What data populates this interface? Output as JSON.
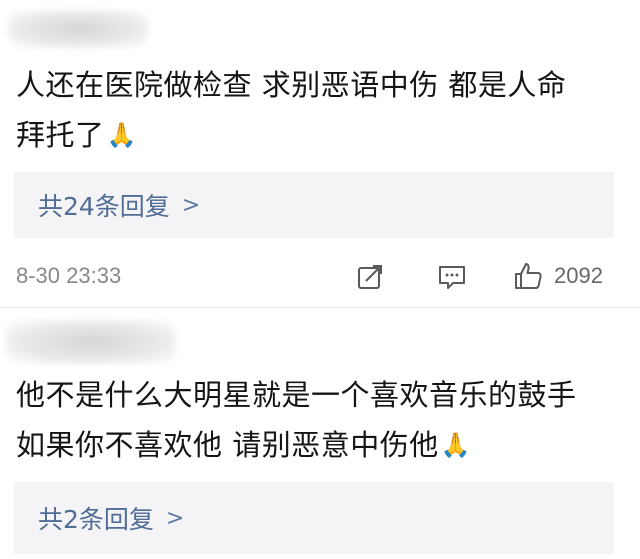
{
  "comments": [
    {
      "text_line1": "人还在医院做检查 求别恶语中伤 都是人命",
      "text_line2": "拜托了",
      "emoji": "🙏",
      "reply_label": "共24条回复",
      "reply_chevron": ">",
      "timestamp": "8-30 23:33",
      "like_count": "2092",
      "icons": [
        "forward-icon",
        "comment-icon",
        "like-icon"
      ]
    },
    {
      "text_line1": "他不是什么大明星就是一个喜欢音乐的鼓手",
      "text_line2": "如果你不喜欢他 请别恶意中伤他",
      "emoji": "🙏",
      "reply_label": "共2条回复",
      "reply_chevron": ">"
    }
  ],
  "colors": {
    "reply_link": "#4f6d96",
    "reply_bg": "#f4f4f6",
    "meta_text": "#888888"
  }
}
